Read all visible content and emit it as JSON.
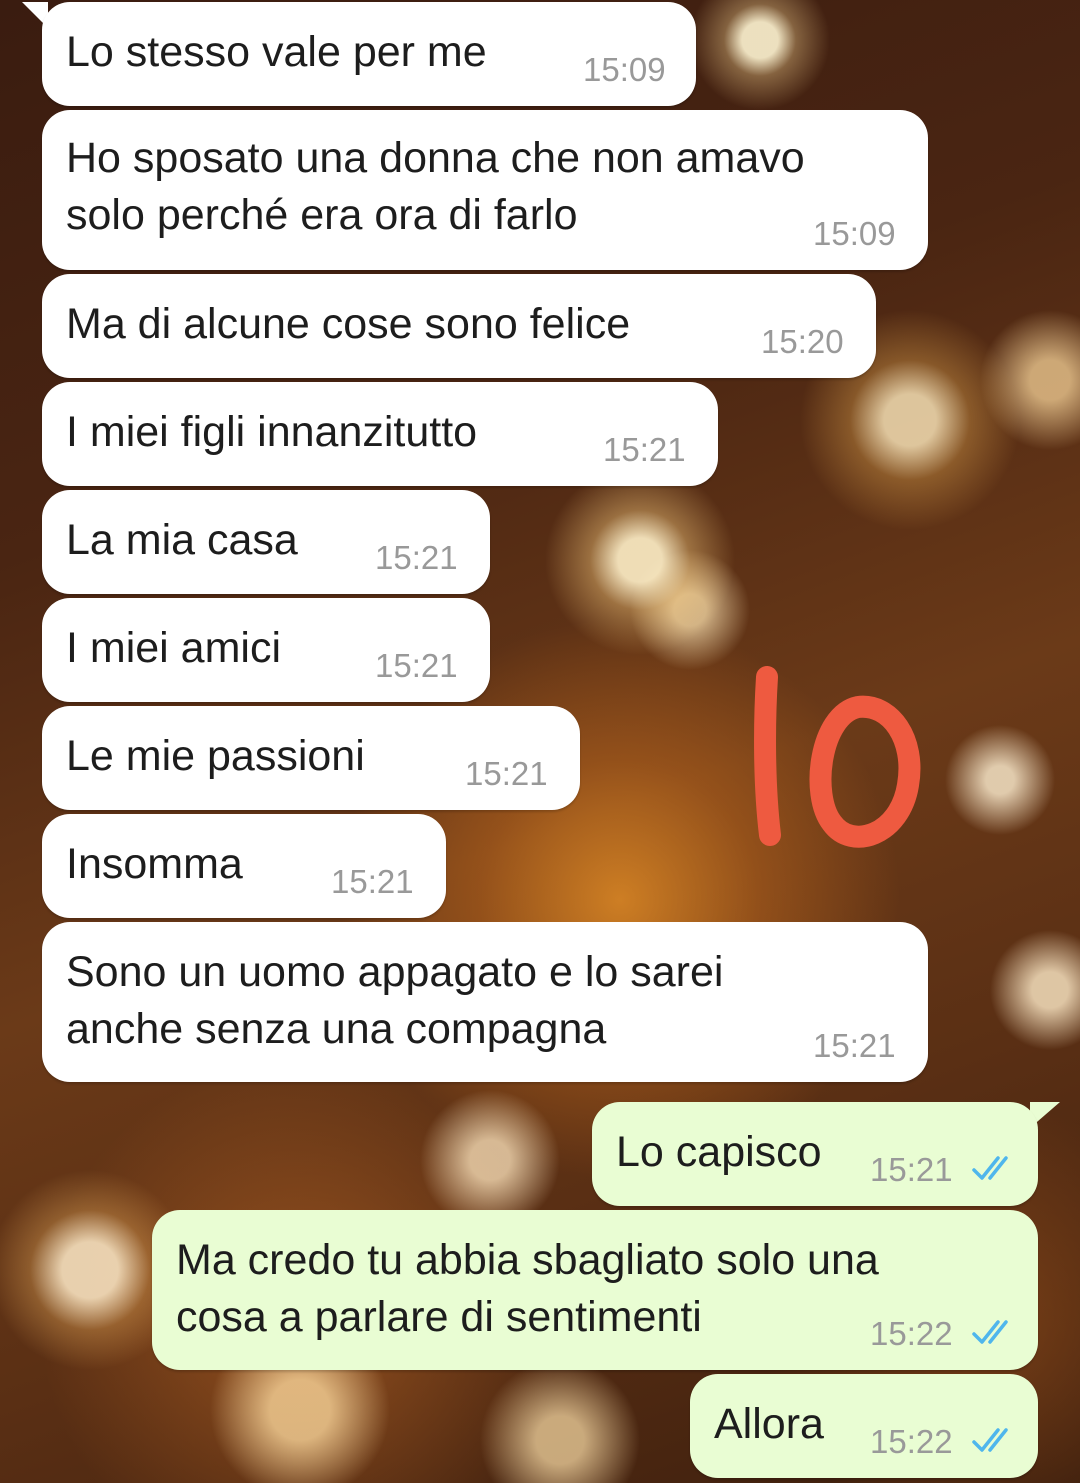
{
  "messages": [
    {
      "direction": "incoming",
      "text": "Lo stesso vale per me",
      "time": "15:09"
    },
    {
      "direction": "incoming",
      "text": "Ho sposato una donna che non amavo\nsolo perché era ora di farlo",
      "time": "15:09"
    },
    {
      "direction": "incoming",
      "text": "Ma di alcune cose sono felice",
      "time": "15:20"
    },
    {
      "direction": "incoming",
      "text": "I miei figli innanzitutto",
      "time": "15:21"
    },
    {
      "direction": "incoming",
      "text": "La mia casa",
      "time": "15:21"
    },
    {
      "direction": "incoming",
      "text": "I miei amici",
      "time": "15:21"
    },
    {
      "direction": "incoming",
      "text": "Le mie passioni",
      "time": "15:21"
    },
    {
      "direction": "incoming",
      "text": "Insomma",
      "time": "15:21"
    },
    {
      "direction": "incoming",
      "text": "Sono un uomo appagato e lo sarei\nanche senza una compagna",
      "time": "15:21"
    },
    {
      "direction": "outgoing",
      "text": "Lo capisco",
      "time": "15:21",
      "status": "read"
    },
    {
      "direction": "outgoing",
      "text": "Ma credo tu abbia sbagliato solo una\ncosa a parlare di sentimenti",
      "time": "15:22",
      "status": "read"
    },
    {
      "direction": "outgoing",
      "text": "Allora",
      "time": "15:22",
      "status": "read"
    }
  ],
  "annotation": {
    "text": "IO",
    "color": "#ee5a40"
  },
  "colors": {
    "incoming_bubble": "#ffffff",
    "outgoing_bubble": "#e9fdd3",
    "timestamp": "#999999",
    "read_ticks": "#4fb6ec"
  },
  "icons": {
    "read_receipt": "double-check-icon"
  }
}
